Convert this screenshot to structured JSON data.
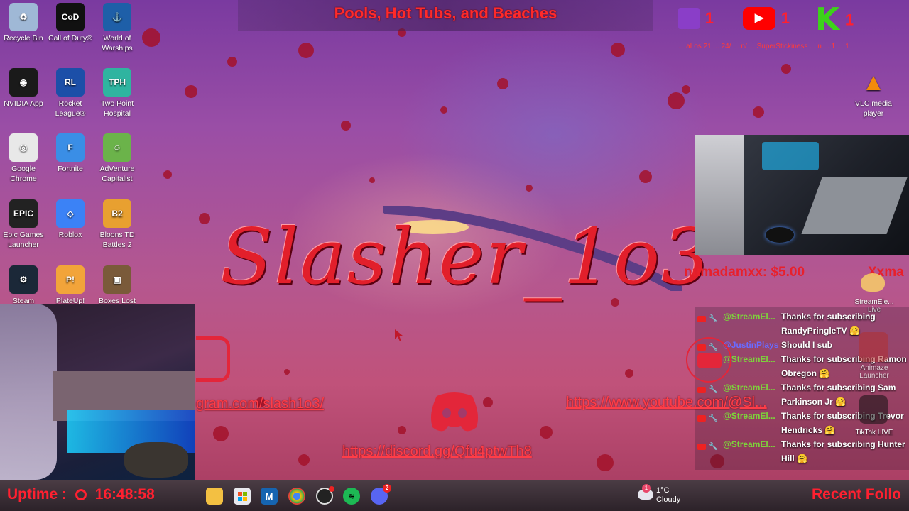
{
  "desktop_icons": [
    {
      "label": "Recycle Bin",
      "color": "#9fb8d6",
      "glyph": "♻"
    },
    {
      "label": "Call of Duty®",
      "color": "#111111",
      "glyph": "CoD"
    },
    {
      "label": "World of Warships",
      "color": "#1e5fa8",
      "glyph": "⚓"
    },
    {
      "label": "NVIDIA App",
      "color": "#1a1a1a",
      "glyph": "◉"
    },
    {
      "label": "Rocket League®",
      "color": "#1c4fa8",
      "glyph": "RL"
    },
    {
      "label": "Two Point Hospital",
      "color": "#2fb4a0",
      "glyph": "TPH"
    },
    {
      "label": "Google Chrome",
      "color": "#e8e8e8",
      "glyph": "◎"
    },
    {
      "label": "Fortnite",
      "color": "#3a8ee6",
      "glyph": "F"
    },
    {
      "label": "AdVenture Capitalist",
      "color": "#6bb34a",
      "glyph": "☺"
    },
    {
      "label": "Epic Games Launcher",
      "color": "#222222",
      "glyph": "EPIC"
    },
    {
      "label": "Roblox",
      "color": "#3b82f6",
      "glyph": "◇"
    },
    {
      "label": "Bloons TD Battles 2",
      "color": "#e8a030",
      "glyph": "B2"
    },
    {
      "label": "Steam",
      "color": "#1b2838",
      "glyph": "⚙"
    },
    {
      "label": "PlateUp!",
      "color": "#f2a43a",
      "glyph": "P!"
    },
    {
      "label": "Boxes Lost",
      "color": "#7a5a3a",
      "glyph": "▣"
    },
    {
      "label": "VLC media player",
      "color": "transparent",
      "glyph": "▲"
    }
  ],
  "banner": {
    "text": "Pools, Hot Tubs, and Beaches"
  },
  "social": {
    "twitch": "1",
    "youtube": "1",
    "kick": "1",
    "kick_letter": "K",
    "youtube_glyph": "▶"
  },
  "ticker": "... aLos 21 ... 24/ ... n/ ... SuperStickiness ... n ... 1 ... 1",
  "logo": "Slasher_1o3",
  "tip": {
    "text": "numadamxx: $5.00",
    "next": "Xxma"
  },
  "overlay_icons": {
    "streamelements": "StreamEle... Live",
    "animaze": "Animaze Launcher",
    "tiktok": "TikTok LIVE"
  },
  "chat": [
    {
      "user": "@StreamEl...",
      "user_color": "#7cd63a",
      "msg": "Thanks for subscribing RandyPringleTV 🤗"
    },
    {
      "user": "@JustinPlays...",
      "user_color": "#6a6bff",
      "msg": "Should I sub"
    },
    {
      "user": "@StreamEl...",
      "user_color": "#7cd63a",
      "msg": "Thanks for subscribing Ramon Obregon 🤗"
    },
    {
      "user": "@StreamEl...",
      "user_color": "#7cd63a",
      "msg": "Thanks for subscribing Sam Parkinson Jr 🤗"
    },
    {
      "user": "@StreamEl...",
      "user_color": "#7cd63a",
      "msg": "Thanks for subscribing Trevor Hendricks 🤗"
    },
    {
      "user": "@StreamEl...",
      "user_color": "#7cd63a",
      "msg": "Thanks for subscribing Hunter Hill 🤗"
    }
  ],
  "links": {
    "instagram": "gram.com/slash1o3/",
    "youtube": "https://www.youtube.com/@Sl...",
    "discord": "https://discord.gg/Qfu4ptwTh8"
  },
  "taskbar": {
    "uptime_label": "Uptime :",
    "uptime_value": "16:48:58",
    "weather_temp": "1°C",
    "weather_desc": "Cloudy",
    "weather_badge": "1",
    "discord_badge": "2",
    "recent": "Recent Follo"
  },
  "colors": {
    "accent_red": "#ff2030",
    "blood": "#a3122a"
  }
}
